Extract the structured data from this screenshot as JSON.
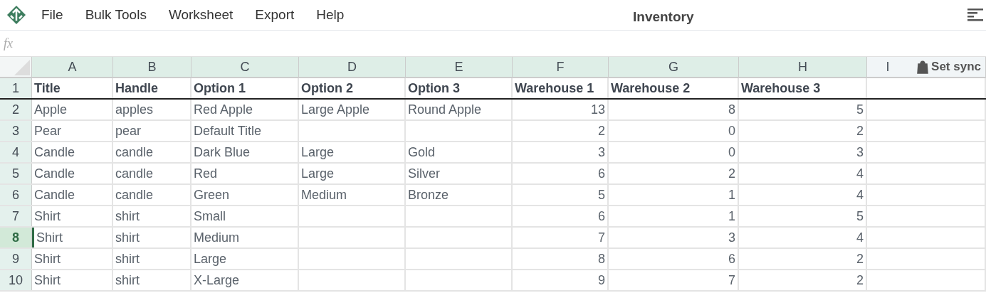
{
  "menu": [
    "File",
    "Bulk Tools",
    "Worksheet",
    "Export",
    "Help"
  ],
  "title": "Inventory",
  "formula_bar": {
    "label": "fx"
  },
  "sync_button": "Set sync",
  "columns": [
    {
      "letter": "A",
      "selected": true,
      "kind": "text"
    },
    {
      "letter": "B",
      "selected": true,
      "kind": "text"
    },
    {
      "letter": "C",
      "selected": true,
      "kind": "text"
    },
    {
      "letter": "D",
      "selected": true,
      "kind": "text"
    },
    {
      "letter": "E",
      "selected": true,
      "kind": "text"
    },
    {
      "letter": "F",
      "selected": true,
      "kind": "number"
    },
    {
      "letter": "G",
      "selected": true,
      "kind": "number"
    },
    {
      "letter": "H",
      "selected": true,
      "kind": "number"
    },
    {
      "letter": "I",
      "selected": false,
      "kind": "text"
    }
  ],
  "rows": [
    {
      "number": "1",
      "selected": false,
      "header": true,
      "cells": [
        "Title",
        "Handle",
        "Option 1",
        "Option 2",
        "Option 3",
        "Warehouse 1",
        "Warehouse 2",
        "Warehouse 3",
        ""
      ]
    },
    {
      "number": "2",
      "selected": false,
      "header": false,
      "cells": [
        "Apple",
        "apples",
        "Red Apple",
        "Large Apple",
        "Round Apple",
        "13",
        "8",
        "5",
        ""
      ]
    },
    {
      "number": "3",
      "selected": false,
      "header": false,
      "cells": [
        "Pear",
        "pear",
        "Default Title",
        "",
        "",
        "2",
        "0",
        "2",
        ""
      ]
    },
    {
      "number": "4",
      "selected": false,
      "header": false,
      "cells": [
        "Candle",
        "candle",
        "Dark Blue",
        "Large",
        "Gold",
        "3",
        "0",
        "3",
        ""
      ]
    },
    {
      "number": "5",
      "selected": false,
      "header": false,
      "cells": [
        "Candle",
        "candle",
        "Red",
        "Large",
        "Silver",
        "6",
        "2",
        "4",
        ""
      ]
    },
    {
      "number": "6",
      "selected": false,
      "header": false,
      "cells": [
        "Candle",
        "candle",
        "Green",
        "Medium",
        "Bronze",
        "5",
        "1",
        "4",
        ""
      ]
    },
    {
      "number": "7",
      "selected": false,
      "header": false,
      "cells": [
        "Shirt",
        "shirt",
        "Small",
        "",
        "",
        "6",
        "1",
        "5",
        ""
      ]
    },
    {
      "number": "8",
      "selected": true,
      "header": false,
      "cells": [
        "Shirt",
        "shirt",
        "Medium",
        "",
        "",
        "7",
        "3",
        "4",
        ""
      ]
    },
    {
      "number": "9",
      "selected": false,
      "header": false,
      "cells": [
        "Shirt",
        "shirt",
        "Large",
        "",
        "",
        "8",
        "6",
        "2",
        ""
      ]
    },
    {
      "number": "10",
      "selected": false,
      "header": false,
      "cells": [
        "Shirt",
        "shirt",
        "X-Large",
        "",
        "",
        "9",
        "7",
        "2",
        ""
      ]
    }
  ]
}
